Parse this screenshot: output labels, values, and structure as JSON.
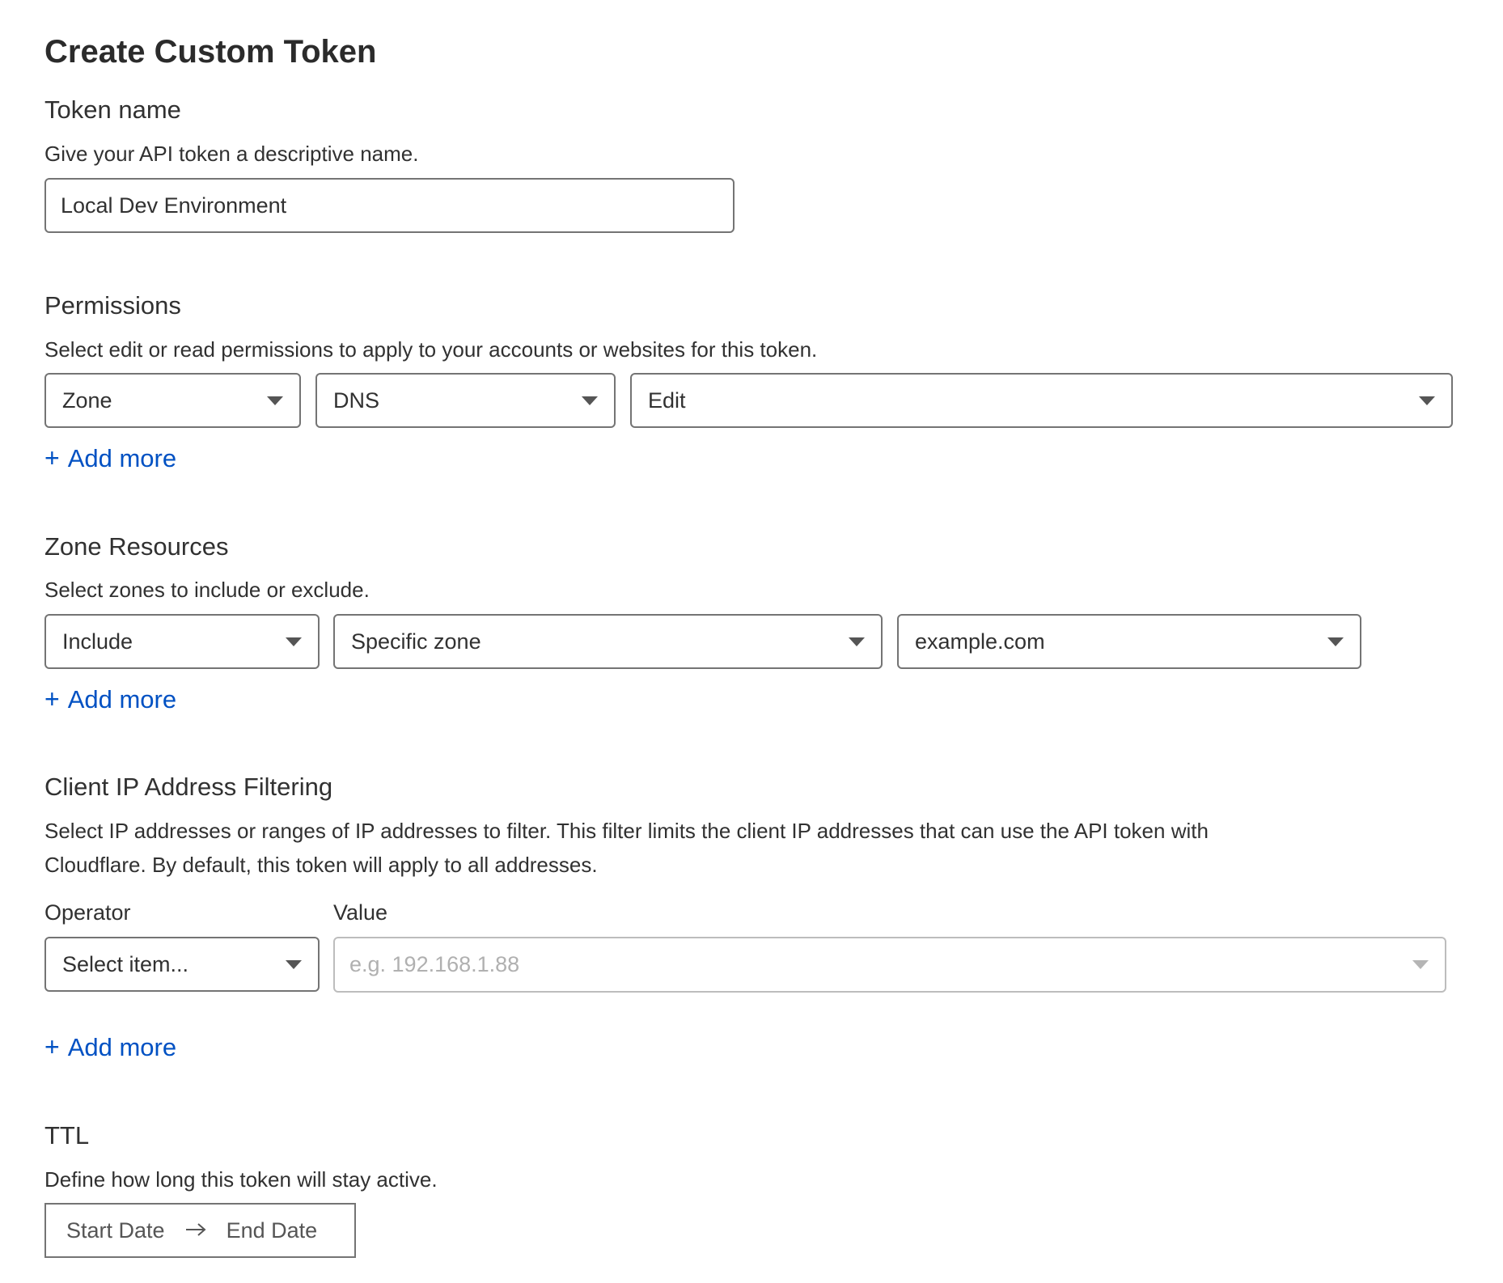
{
  "page": {
    "title": "Create Custom Token"
  },
  "token_name": {
    "heading": "Token name",
    "description": "Give your API token a descriptive name.",
    "value": "Local Dev Environment"
  },
  "permissions": {
    "heading": "Permissions",
    "description": "Select edit or read permissions to apply to your accounts or websites for this token.",
    "selects": [
      "Zone",
      "DNS",
      "Edit"
    ],
    "add_more": "Add more"
  },
  "zone_resources": {
    "heading": "Zone Resources",
    "description": "Select zones to include or exclude.",
    "selects": [
      "Include",
      "Specific zone",
      "example.com"
    ],
    "add_more": "Add more"
  },
  "ip_filtering": {
    "heading": "Client IP Address Filtering",
    "description_line1": "Select IP addresses or ranges of IP addresses to filter. This filter limits the client IP addresses that can use the API token with",
    "description_line2": "Cloudflare. By default, this token will apply to all addresses.",
    "operator_label": "Operator",
    "value_label": "Value",
    "operator_value": "Select item...",
    "value_placeholder": "e.g. 192.168.1.88",
    "add_more": "Add more"
  },
  "ttl": {
    "heading": "TTL",
    "description": "Define how long this token will stay active.",
    "start_date": "Start Date",
    "end_date": "End Date",
    "arrow_icon": "arrow-right"
  },
  "colors": {
    "link": "#0051c3",
    "text": "#313131",
    "border": "#747474"
  }
}
